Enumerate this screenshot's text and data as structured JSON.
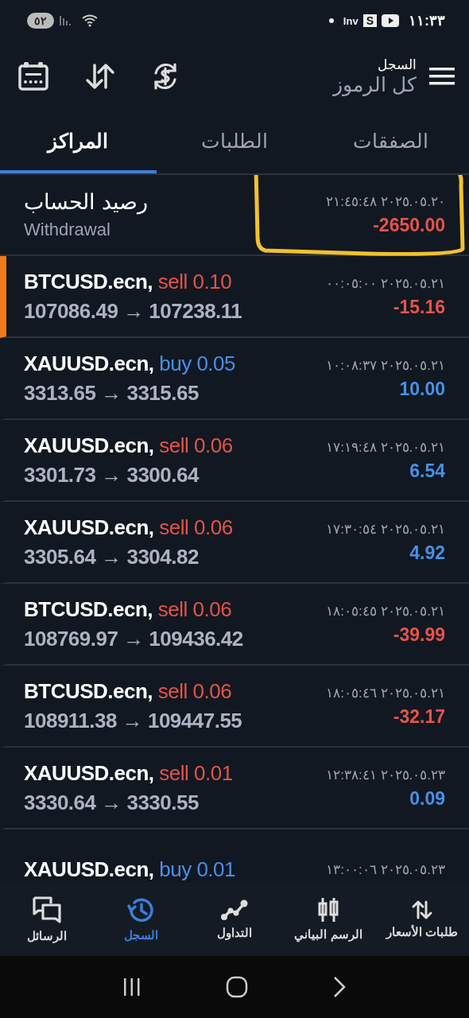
{
  "status_bar": {
    "time": "١١:٣٣",
    "notification_labels": [
      "S",
      "Inv"
    ],
    "battery": "٥٢"
  },
  "header": {
    "title": "السجل",
    "subtitle": "كل الرموز"
  },
  "tabs": [
    {
      "label": "الصفقات",
      "selected": false
    },
    {
      "label": "الطلبات",
      "selected": false
    },
    {
      "label": "المراكز",
      "selected": true
    }
  ],
  "balance": {
    "title": "رصيد الحساب",
    "subtitle": "Withdrawal",
    "time": "٢٠٢٥.٠٥.٢٠ ٢١:٤٥:٤٨",
    "amount": "-2650.00",
    "loss": true
  },
  "trades": [
    {
      "symbol": "BTCUSD.ecn,",
      "order": "sell 0.10",
      "kind": "sell",
      "prices": "107086.49 → 107238.11",
      "time": "٢٠٢٥.٠٥.٢١ ٠٠:٠٥:٠٠",
      "profit": "-15.16",
      "loss": true,
      "selected": true
    },
    {
      "symbol": "XAUUSD.ecn,",
      "order": "buy 0.05",
      "kind": "buy",
      "prices": "3313.65 → 3315.65",
      "time": "٢٠٢٥.٠٥.٢١ ١٠:٠٨:٣٧",
      "profit": "10.00",
      "loss": false,
      "selected": false
    },
    {
      "symbol": "XAUUSD.ecn,",
      "order": "sell 0.06",
      "kind": "sell",
      "prices": "3301.73 → 3300.64",
      "time": "٢٠٢٥.٠٥.٢١ ١٧:١٩:٤٨",
      "profit": "6.54",
      "loss": false,
      "selected": false
    },
    {
      "symbol": "XAUUSD.ecn,",
      "order": "sell 0.06",
      "kind": "sell",
      "prices": "3305.64 → 3304.82",
      "time": "٢٠٢٥.٠٥.٢١ ١٧:٣٠:٥٤",
      "profit": "4.92",
      "loss": false,
      "selected": false
    },
    {
      "symbol": "BTCUSD.ecn,",
      "order": "sell 0.06",
      "kind": "sell",
      "prices": "108769.97 → 109436.42",
      "time": "٢٠٢٥.٠٥.٢١ ١٨:٠٥:٤٥",
      "profit": "-39.99",
      "loss": true,
      "selected": false
    },
    {
      "symbol": "BTCUSD.ecn,",
      "order": "sell 0.06",
      "kind": "sell",
      "prices": "108911.38 → 109447.55",
      "time": "٢٠٢٥.٠٥.٢١ ١٨:٠٥:٤٦",
      "profit": "-32.17",
      "loss": true,
      "selected": false
    },
    {
      "symbol": "XAUUSD.ecn,",
      "order": "sell 0.01",
      "kind": "sell",
      "prices": "3330.64 → 3330.55",
      "time": "٢٠٢٥.٠٥.٢٣ ١٢:٣٨:٤١",
      "profit": "0.09",
      "loss": false,
      "selected": false
    },
    {
      "symbol": "XAUUSD.ecn,",
      "order": "buy 0.01",
      "kind": "buy",
      "time": "٢٠٢٥.٠٥.٢٣ ١٣:٠٠:٠٦",
      "selected": false
    }
  ],
  "bottom_nav": [
    {
      "label": "طلبات الأسعار",
      "kind": "quotes",
      "selected": false
    },
    {
      "label": "الرسم البياني",
      "kind": "chart",
      "selected": false
    },
    {
      "label": "التداول",
      "kind": "trade",
      "selected": false
    },
    {
      "label": "السجل",
      "kind": "history",
      "selected": true
    },
    {
      "label": "الرسائل",
      "kind": "messages",
      "selected": false
    }
  ]
}
